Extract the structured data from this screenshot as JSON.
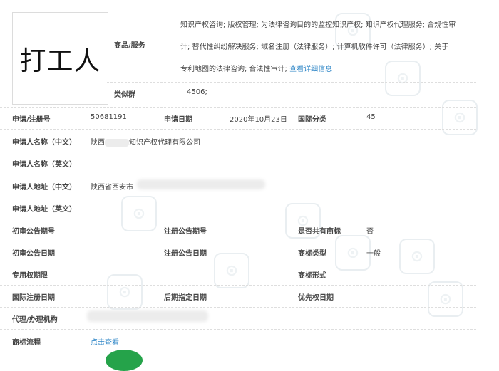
{
  "logo": {
    "text": "打工人"
  },
  "goods": {
    "label": "商品/服务",
    "lines": [
      "知识产权咨询; 版权管理; 为法律咨询目的的监控知识产权; 知识产权代理服务; 合规性审",
      "计; 替代性纠纷解决服务; 域名注册（法律服务）; 计算机软件许可（法律服务）; 关于",
      "专利地图的法律咨询; 合法性审计; "
    ],
    "more_link": "查看详细信息"
  },
  "similar_group": {
    "label": "类似群",
    "value": "4506;"
  },
  "reg": {
    "number_label": "申请/注册号",
    "number": "50681191",
    "date_label": "申请日期",
    "date": "2020年10月23日",
    "class_label": "国际分类",
    "class": "45"
  },
  "applicant": {
    "name_cn_label": "申请人名称（中文）",
    "name_cn_prefix": "陕西",
    "name_cn_suffix": "知识产权代理有限公司",
    "name_en_label": "申请人名称（英文）",
    "addr_cn_label": "申请人地址（中文）",
    "addr_cn": "陕西省西安市",
    "addr_en_label": "申请人地址（英文）"
  },
  "announcements": {
    "prelim_no_label": "初审公告期号",
    "reg_no_label": "注册公告期号",
    "shared_label": "是否共有商标",
    "shared": "否",
    "prelim_date_label": "初审公告日期",
    "reg_date_label": "注册公告日期",
    "type_label": "商标类型",
    "type": "一般",
    "exclusive_label": "专用权期限",
    "form_label": "商标形式",
    "intl_date_label": "国际注册日期",
    "later_date_label": "后期指定日期",
    "priority_label": "优先权日期"
  },
  "agent": {
    "label": "代理/办理机构"
  },
  "process": {
    "label": "商标流程",
    "link": "点击查看"
  },
  "colors": {
    "link": "#2b84c6",
    "watermark": "#e9eef1"
  }
}
